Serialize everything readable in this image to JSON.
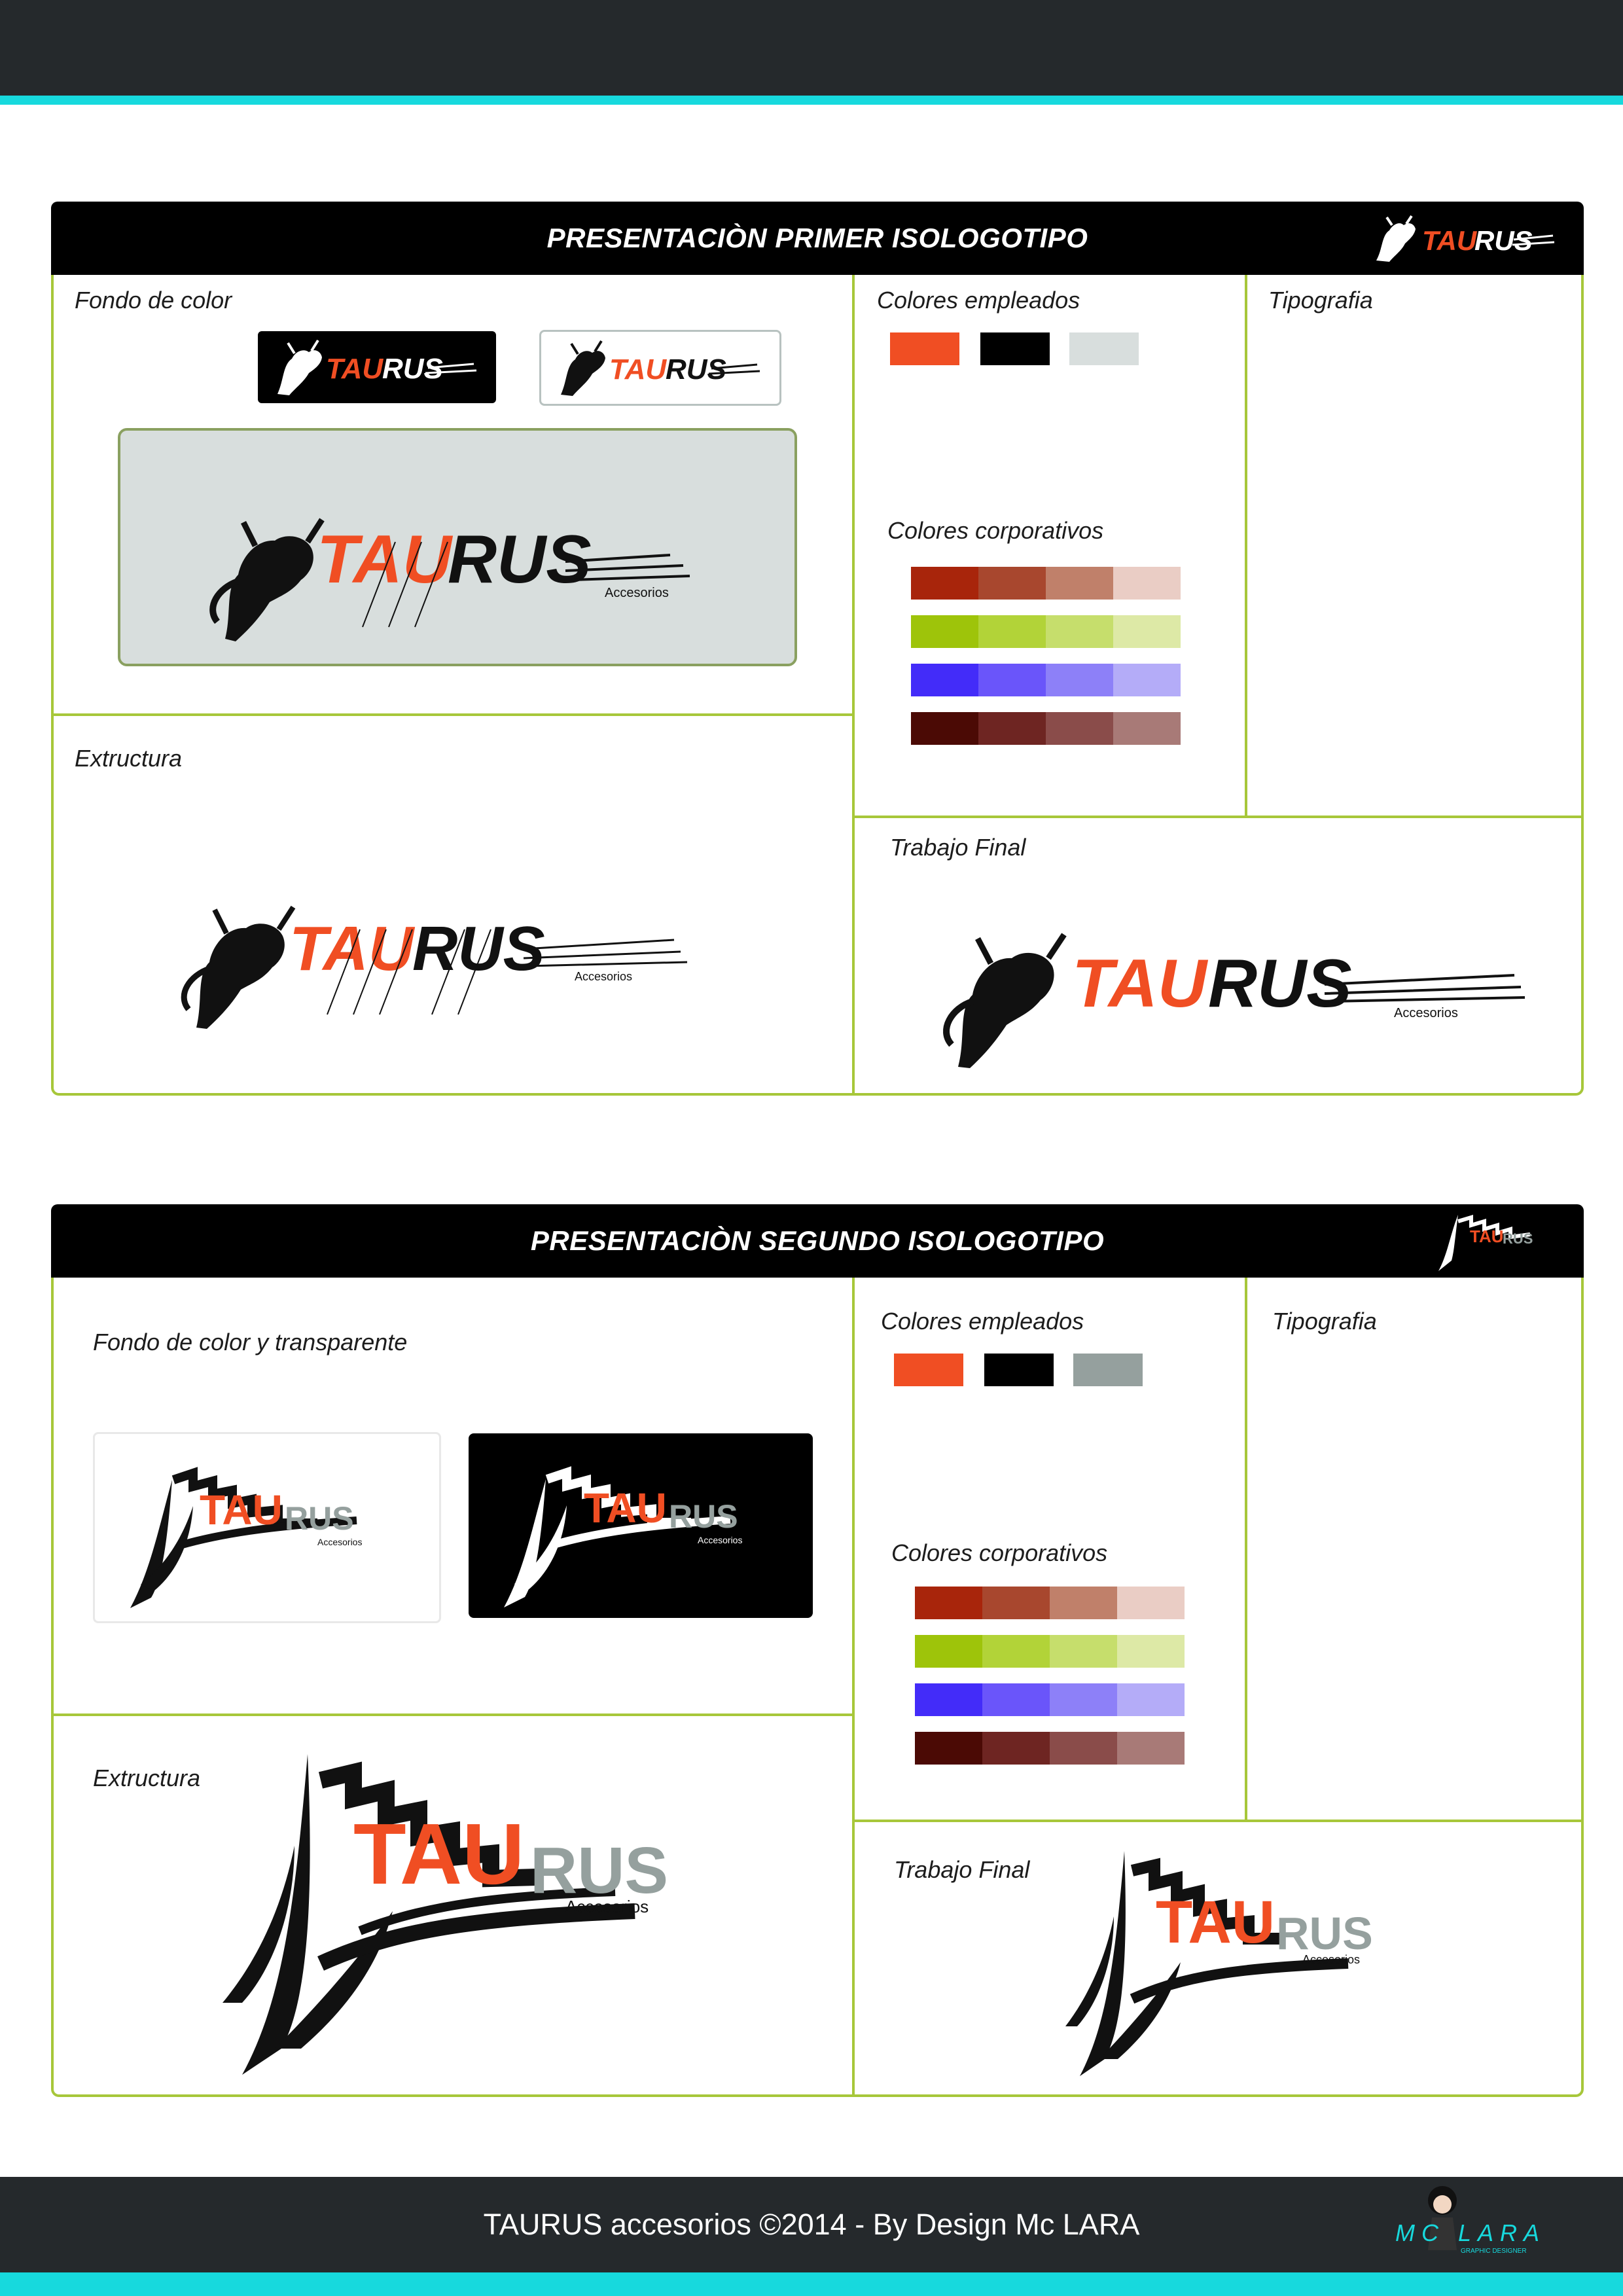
{
  "colors": {
    "topbar": "#25292c",
    "cyan": "#17d9dd",
    "green_border": "#a7c73a",
    "orange": "#f04e23",
    "black": "#000000",
    "light_gray": "#d8dedd",
    "mid_gray": "#95a09e"
  },
  "panel1": {
    "title": "PRESENTACIÒN  PRIMER ISOLOGOTIPO",
    "fondo_label": "Fondo de color",
    "colores_empleados_label": "Colores empleados",
    "tipografia_label": "Tipografia",
    "colores_corporativos_label": "Colores corporativos",
    "extructura_label": "Extructura",
    "trabajo_final_label": "Trabajo Final",
    "colores_empleados": [
      "#f04e23",
      "#000000",
      "#d8dedd"
    ],
    "logo_word_orange": "TAU",
    "logo_word_black": "RUS",
    "logo_sub": "Accesorios"
  },
  "panel2": {
    "title": "PRESENTACIÒN  SEGUNDO ISOLOGOTIPO",
    "fondo_label": "Fondo de color y transparente",
    "colores_empleados_label": "Colores empleados",
    "tipografia_label": "Tipografia",
    "colores_corporativos_label": "Colores corporativos",
    "extructura_label": "Extructura",
    "trabajo_final_label": "Trabajo Final",
    "colores_empleados": [
      "#f04e23",
      "#000000",
      "#95a09e"
    ],
    "logo_word_orange": "TAU",
    "logo_word_gray": "RUS",
    "logo_sub": "Accesorios"
  },
  "corporate_palette": [
    [
      "#a8250b",
      "#a8472e",
      "#c0806a",
      "#eacdc5"
    ],
    [
      "#9ec40a",
      "#b2d338",
      "#c6de6c",
      "#dde9a6"
    ],
    [
      "#432cf9",
      "#6a55fa",
      "#8d80f8",
      "#b4acf8"
    ],
    [
      "#4b0a05",
      "#6e2522",
      "#8a4c4a",
      "#a87a77"
    ]
  ],
  "footer": {
    "text": "TAURUS accesorios ©2014  - By Design Mc LARA",
    "brand_mark": "MC LARA",
    "brand_sub": "GRAPHIC DESIGNER"
  }
}
